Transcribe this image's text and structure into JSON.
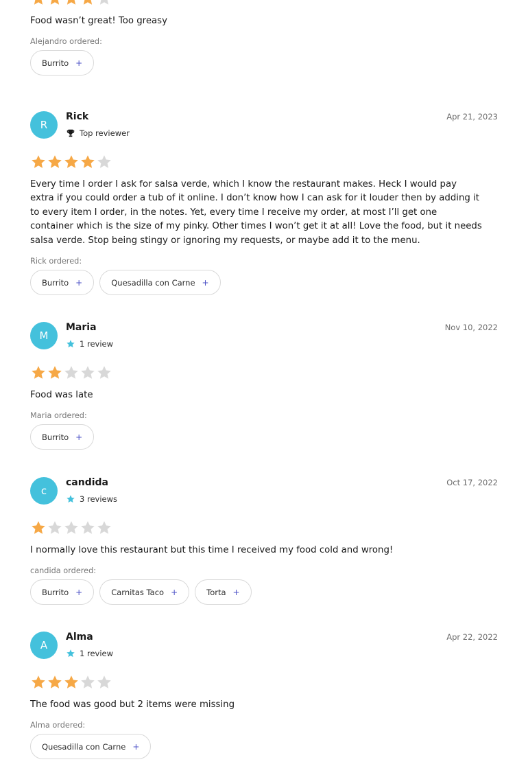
{
  "colors": {
    "avatar_bg": "#44c1dc",
    "star_filled": "#f6a846",
    "star_empty": "#d8d8d8",
    "badge_star": "#44c1dc",
    "plus": "#4b50c6"
  },
  "reviews": [
    {
      "rating": 4,
      "text": "Food wasn’t great! Too greasy",
      "ordered_label": "Alejandro ordered:",
      "items": [
        "Burrito"
      ]
    },
    {
      "initial": "R",
      "name": "Rick",
      "badge_icon": "trophy-icon",
      "badge": "Top reviewer",
      "date": "Apr 21, 2023",
      "rating": 4,
      "text": "Every time I order I ask for salsa verde, which I know the restaurant makes. Heck I would pay extra if you could order a tub of it online. I don’t know how I can ask for it louder then by adding it to every item I order, in the notes. Yet, every time I receive my order, at most I’ll get one container which is the size of my pinky. Other times I won’t get it at all! Love the food, but it needs salsa verde. Stop being stingy or ignoring my requests, or maybe add it to the menu.",
      "ordered_label": "Rick ordered:",
      "items": [
        "Burrito",
        "Quesadilla con Carne"
      ]
    },
    {
      "initial": "M",
      "name": "Maria",
      "badge_icon": "star-badge-icon",
      "badge": "1 review",
      "date": "Nov 10, 2022",
      "rating": 2,
      "text": "Food was late",
      "ordered_label": "Maria ordered:",
      "items": [
        "Burrito"
      ]
    },
    {
      "initial": "c",
      "name": "candida",
      "badge_icon": "star-badge-icon",
      "badge": "3 reviews",
      "date": "Oct 17, 2022",
      "rating": 1,
      "text": "I normally love this restaurant but this time I received my food cold and wrong!",
      "ordered_label": "candida ordered:",
      "items": [
        "Burrito",
        "Carnitas Taco",
        "Torta"
      ]
    },
    {
      "initial": "A",
      "name": "Alma",
      "badge_icon": "star-badge-icon",
      "badge": "1 review",
      "date": "Apr 22, 2022",
      "rating": 3,
      "text": "The food was good but 2 items were missing",
      "ordered_label": "Alma ordered:",
      "items": [
        "Quesadilla con Carne"
      ]
    }
  ]
}
